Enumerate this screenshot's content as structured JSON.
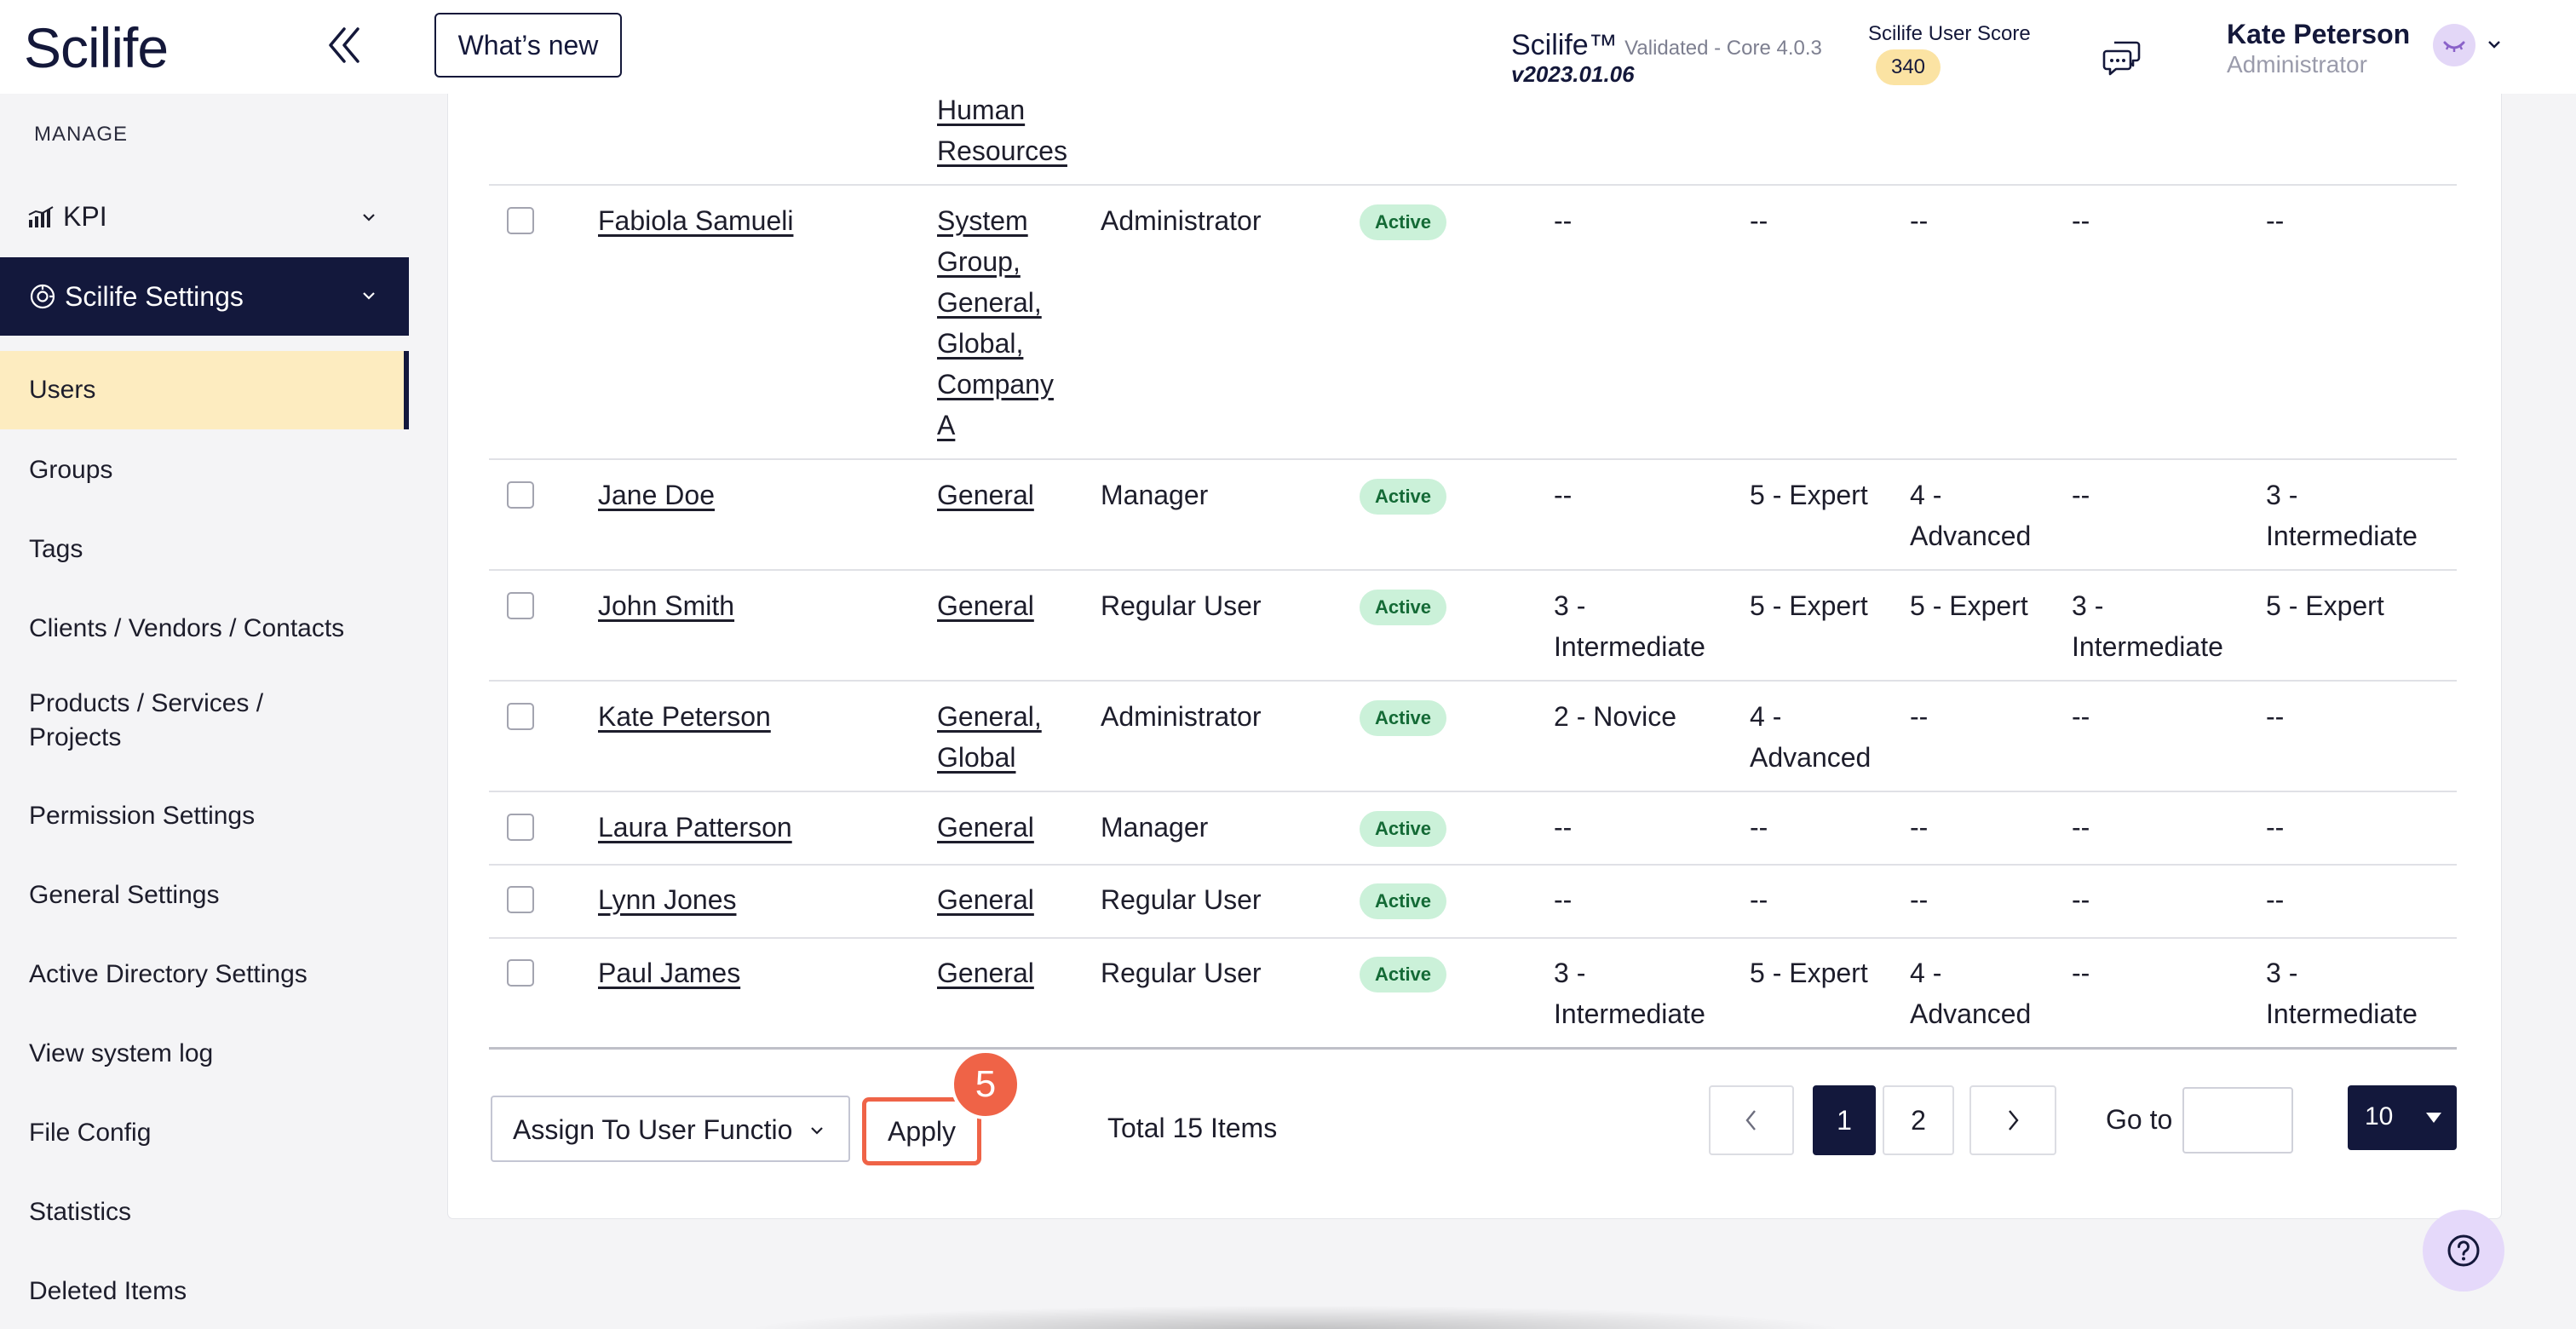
{
  "header": {
    "logo": "Scilife",
    "whats_new": "What’s new",
    "app_name": "Scilife™",
    "app_validated": "Validated - Core 4.0.3",
    "app_version": "v2023.01.06",
    "score_label": "Scilife User Score",
    "score_value": "340",
    "user_name": "Kate Peterson",
    "user_role": "Administrator"
  },
  "sidebar": {
    "section": "MANAGE",
    "kpi": "KPI",
    "settings": "Scilife Settings",
    "items": [
      {
        "label": "Users",
        "active": true
      },
      {
        "label": "Groups"
      },
      {
        "label": "Tags"
      },
      {
        "label": "Clients / Vendors / Contacts"
      },
      {
        "label": "Products / Services / Projects"
      },
      {
        "label": "Permission Settings"
      },
      {
        "label": "General Settings"
      },
      {
        "label": "Active Directory Settings"
      },
      {
        "label": "View system log"
      },
      {
        "label": "File Config"
      },
      {
        "label": "Statistics"
      },
      {
        "label": "Deleted Items"
      }
    ]
  },
  "table": {
    "partial_group": "Human Resources",
    "rows": [
      {
        "name": "Fabiola Samueli",
        "groups": "System Group, General, Global, Company A",
        "role": "Administrator",
        "status": "Active",
        "c1": "--",
        "c2": "--",
        "c3": "--",
        "c4": "--",
        "c5": "--"
      },
      {
        "name": "Jane Doe",
        "groups": "General",
        "role": "Manager",
        "status": "Active",
        "c1": "--",
        "c2": "5 - Expert",
        "c3": "4 - Advanced",
        "c4": "--",
        "c5": "3 - Intermediate"
      },
      {
        "name": "John Smith",
        "groups": "General",
        "role": "Regular User",
        "status": "Active",
        "c1": "3 - Intermediate",
        "c2": "5 - Expert",
        "c3": "5 - Expert",
        "c4": "3 - Intermediate",
        "c5": "5 - Expert"
      },
      {
        "name": "Kate Peterson",
        "groups": "General, Global",
        "role": "Administrator",
        "status": "Active",
        "c1": "2 - Novice",
        "c2": "4 - Advanced",
        "c3": "--",
        "c4": "--",
        "c5": "--"
      },
      {
        "name": "Laura Patterson",
        "groups": "General",
        "role": "Manager",
        "status": "Active",
        "c1": "--",
        "c2": "--",
        "c3": "--",
        "c4": "--",
        "c5": "--"
      },
      {
        "name": "Lynn Jones",
        "groups": "General",
        "role": "Regular User",
        "status": "Active",
        "c1": "--",
        "c2": "--",
        "c3": "--",
        "c4": "--",
        "c5": "--"
      },
      {
        "name": "Paul James",
        "groups": "General",
        "role": "Regular User",
        "status": "Active",
        "c1": "3 - Intermediate",
        "c2": "5 - Expert",
        "c3": "4 - Advanced",
        "c4": "--",
        "c5": "3 - Intermediate"
      }
    ]
  },
  "footer": {
    "bulk_action": "Assign To User Functio",
    "apply": "Apply",
    "step": "5",
    "total": "Total 15 Items",
    "pages": [
      "1",
      "2"
    ],
    "current_page": "1",
    "goto_label": "Go to",
    "goto_value": "",
    "page_size": "10"
  },
  "colors": {
    "navy": "#13183c",
    "active_bg": "#fdecc0",
    "highlight": "#ef6347",
    "status_bg": "#cbf1d9",
    "score_bg": "#fbe3a3"
  },
  "icons": [
    "collapse-icon",
    "chat-icon",
    "avatar-icon",
    "chevron-down-icon",
    "kpi-chart-icon",
    "settings-icon",
    "chevron-left-icon",
    "chevron-right-icon",
    "caret-down-icon",
    "help-icon"
  ]
}
